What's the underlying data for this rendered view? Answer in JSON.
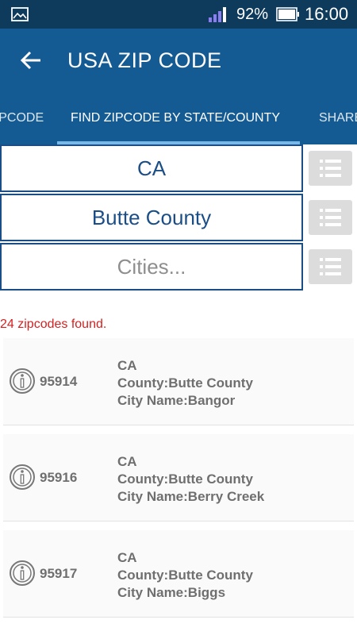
{
  "status_bar": {
    "battery_percent": "92%",
    "time": "16:00"
  },
  "app_bar": {
    "title": "USA ZIP CODE"
  },
  "tabs": [
    {
      "label": "ZIPCODE"
    },
    {
      "label": "FIND ZIPCODE BY STATE/COUNTY"
    },
    {
      "label": "SHARE"
    }
  ],
  "filters": {
    "state_value": "CA",
    "county_value": "Butte County",
    "city_placeholder": "Cities..."
  },
  "results": {
    "count_text": "24 zipcodes found.",
    "items": [
      {
        "zip": "95914",
        "state": "CA",
        "county": "County:Butte County",
        "city": "City Name:Bangor"
      },
      {
        "zip": "95916",
        "state": "CA",
        "county": "County:Butte County",
        "city": "City Name:Berry Creek"
      },
      {
        "zip": "95917",
        "state": "CA",
        "county": "County:Butte County",
        "city": "City Name:Biggs"
      }
    ]
  },
  "colors": {
    "status_bar": "#0e3a5c",
    "app_bar": "#155b93",
    "tab_indicator": "#79b9ea",
    "accent_text": "#1b4e86",
    "count_text": "#d42020"
  }
}
